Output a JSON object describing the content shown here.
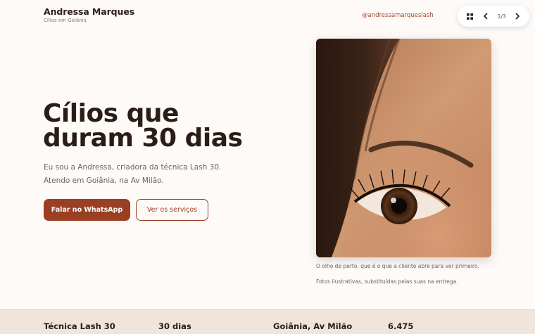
{
  "header": {
    "brand_name": "Andressa Marques",
    "brand_subtitle": "Cílios em Goiânia",
    "handle": "@andressamarqueslash"
  },
  "pager": {
    "counter": "1/3",
    "grid_icon": "grid-icon",
    "prev_icon": "chevron-left-icon",
    "next_icon": "chevron-right-icon"
  },
  "hero": {
    "title_line1": "Cílios que",
    "title_line2": "duram 30 dias",
    "desc_line1": "Eu sou a Andressa, criadora da técnica Lash 30.",
    "desc_line2": "Atendo em Goiânia, na Av Milão.",
    "primary_button": "Falar no WhatsApp",
    "secondary_button": "Ver os serviços"
  },
  "photo": {
    "caption1": "O olho de perto, que é o que a cliente abre para ver primeiro.",
    "caption2": "Fotos ilustrativas, substituídas pelas suas na entrega."
  },
  "stats": [
    {
      "label": "Técnica Lash 30"
    },
    {
      "label": "30 dias"
    },
    {
      "label": "Goiânia, Av Milão"
    },
    {
      "label": "6.475"
    }
  ],
  "colors": {
    "accent": "#9a3f22",
    "background": "#fdfaf7",
    "footer": "#f1e4db"
  }
}
